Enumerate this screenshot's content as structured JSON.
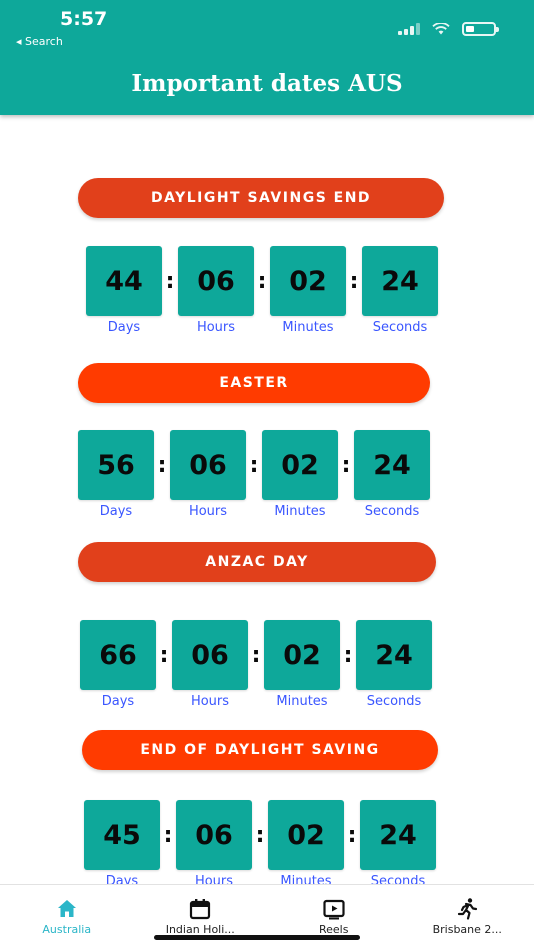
{
  "status": {
    "time": "5:57",
    "back_label": "◂ Search"
  },
  "header": {
    "title": "Important dates AUS"
  },
  "colors": {
    "teal": "#0ea89a",
    "pill_dark": "#e1401b",
    "pill_bright": "#ff3b00",
    "unit_label": "#3a56ff",
    "tab_active": "#2bb6c8"
  },
  "events": [
    {
      "title": "DAYLIGHT SAVINGS END",
      "color": "#e1401b",
      "days": "44",
      "hours": "06",
      "minutes": "02",
      "seconds": "24"
    },
    {
      "title": "EASTER",
      "color": "#ff3b00",
      "days": "56",
      "hours": "06",
      "minutes": "02",
      "seconds": "24"
    },
    {
      "title": "ANZAC DAY",
      "color": "#e1401b",
      "days": "66",
      "hours": "06",
      "minutes": "02",
      "seconds": "24"
    },
    {
      "title": "END OF DAYLIGHT SAVING",
      "color": "#ff3b00",
      "days": "45",
      "hours": "06",
      "minutes": "02",
      "seconds": "24"
    }
  ],
  "units": {
    "days": "Days",
    "hours": "Hours",
    "minutes": "Minutes",
    "seconds": "Seconds"
  },
  "tabs": [
    {
      "label": "Australia",
      "icon": "home-icon",
      "active": true
    },
    {
      "label": "Indian Holi...",
      "icon": "calendar-icon",
      "active": false
    },
    {
      "label": "Reels",
      "icon": "video-icon",
      "active": false
    },
    {
      "label": "Brisbane 2...",
      "icon": "runner-icon",
      "active": false
    }
  ]
}
